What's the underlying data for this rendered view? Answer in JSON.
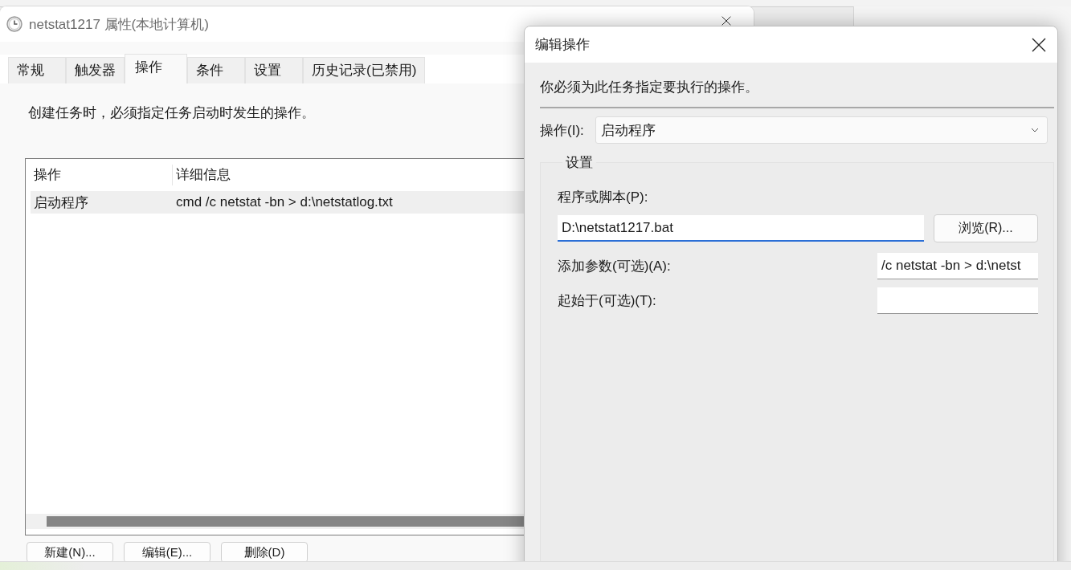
{
  "properties_dialog": {
    "title": "netstat1217 属性(本地计算机)",
    "tabs": [
      {
        "label": "常规",
        "selected": false
      },
      {
        "label": "触发器",
        "selected": false
      },
      {
        "label": "操作",
        "selected": true
      },
      {
        "label": "条件",
        "selected": false
      },
      {
        "label": "设置",
        "selected": false
      },
      {
        "label": "历史记录(已禁用)",
        "selected": false
      }
    ],
    "description": "创建任务时，必须指定任务启动时发生的操作。",
    "actions_table": {
      "columns": [
        "操作",
        "详细信息"
      ],
      "rows": [
        {
          "cells": [
            "启动程序",
            "cmd /c netstat -bn > d:\\netstatlog.txt"
          ],
          "selected": true
        }
      ]
    },
    "buttons": [
      "新建(N)...",
      "编辑(E)...",
      "删除(D)"
    ]
  },
  "edit_action_dialog": {
    "title": "编辑操作",
    "instruction": "你必须为此任务指定要执行的操作。",
    "action_field": {
      "label": "操作(I):",
      "value": "启动程序"
    },
    "settings_group": {
      "title": "设置",
      "program_field": {
        "label": "程序或脚本(P):",
        "value": "D:\\netstat1217.bat",
        "focused": true
      },
      "browse_button": "浏览(R)...",
      "arguments_field": {
        "label": "添加参数(可选)(A):",
        "value": "/c netstat -bn > d:\\netst",
        "focused": false
      },
      "start_in_field": {
        "label": "起始于(可选)(T):",
        "focused": false
      }
    }
  }
}
